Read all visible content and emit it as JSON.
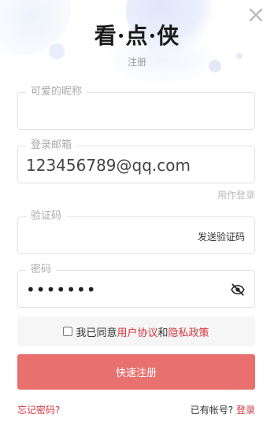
{
  "header": {
    "logo_text": "看·点·侠",
    "subtitle": "注册"
  },
  "form": {
    "nickname": {
      "label": "可爱的昵称",
      "value": ""
    },
    "email": {
      "label": "登录邮箱",
      "value": "123456789@qq.com"
    },
    "use_phone_link": "用作登录",
    "verify_code": {
      "label": "验证码",
      "value": "",
      "send_button": "发送验证码"
    },
    "password": {
      "label": "密码",
      "masked_value": "•••••••"
    }
  },
  "agreement": {
    "prefix": "我已同意",
    "terms_link": "用户协议",
    "and": "和",
    "privacy_link": "隐私政策",
    "checked": false
  },
  "submit_label": "快速注册",
  "footer": {
    "forgot_password": "忘记密码?",
    "has_account": "已有帐号?",
    "login_link": "登录"
  },
  "icons": {
    "close": "close-icon",
    "password_visibility": "eye-off-icon"
  },
  "colors": {
    "accent": "#d9363e",
    "submit_bg": "#e8716f",
    "border": "#e2e2e2"
  }
}
